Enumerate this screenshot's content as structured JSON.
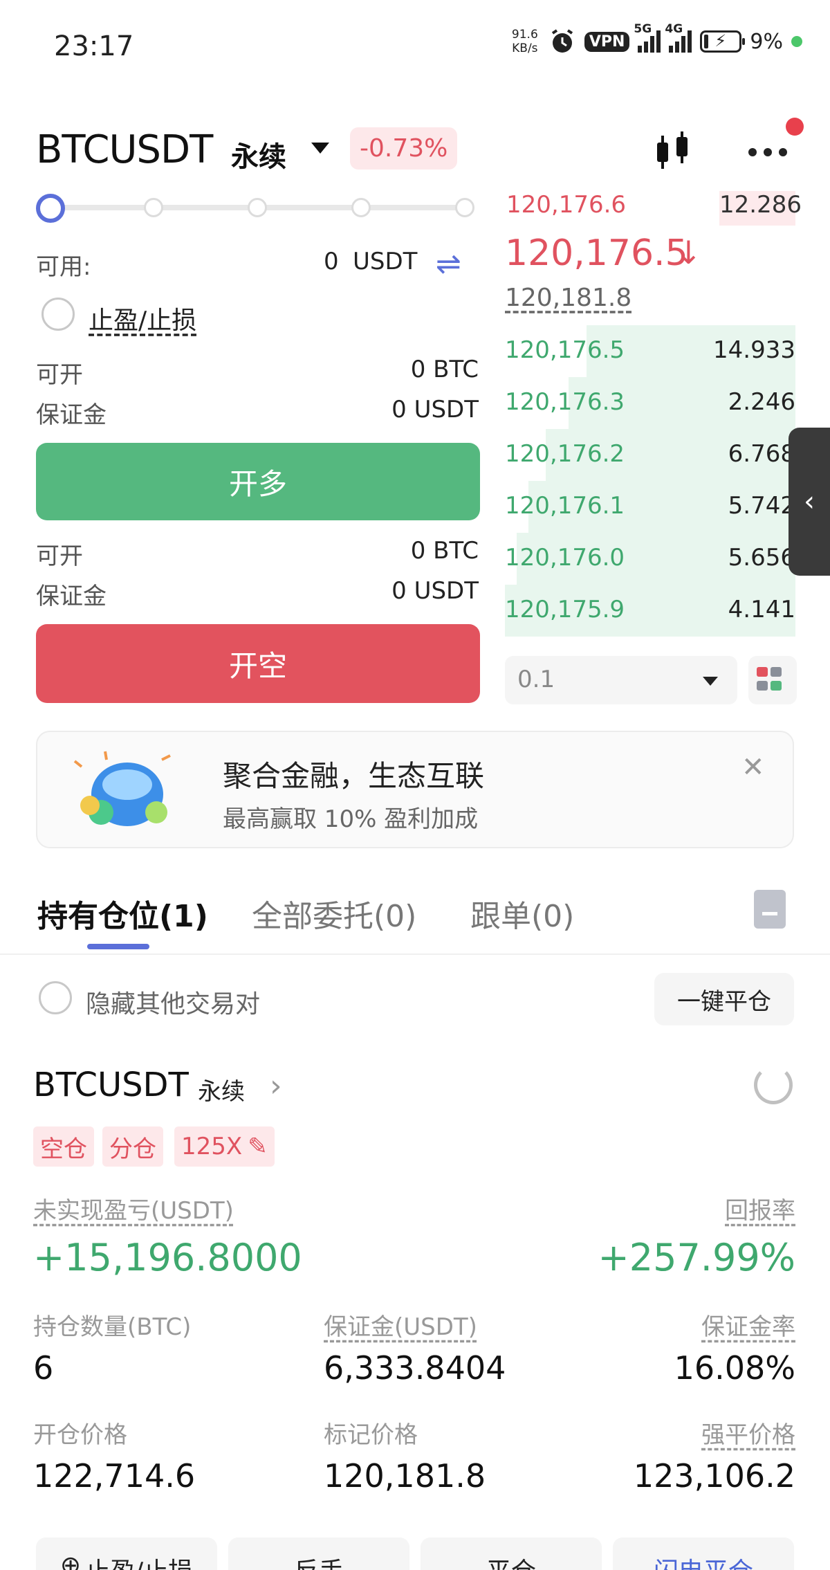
{
  "status_bar": {
    "time": "23:17",
    "net_speed_value": "91.6",
    "net_speed_unit": "KB/s",
    "vpn": "VPN",
    "sim1": "5G",
    "sim2": "4G",
    "battery": "9%",
    "icons": [
      "alarm-icon",
      "signal-icon",
      "battery-charging-icon"
    ]
  },
  "header": {
    "symbol": "BTCUSDT",
    "contract": "永续",
    "change": "-0.73%"
  },
  "order_form": {
    "available_label": "可用:",
    "available_value": "0",
    "available_unit": "USDT",
    "tp_sl_label": "止盈/止损",
    "long": {
      "open_label": "可开",
      "open_value": "0 BTC",
      "margin_label": "保证金",
      "margin_value": "0 USDT",
      "button": "开多"
    },
    "short": {
      "open_label": "可开",
      "open_value": "0 BTC",
      "margin_label": "保证金",
      "margin_value": "0 USDT",
      "button": "开空"
    }
  },
  "order_book": {
    "top_ask": {
      "price": "120,176.6",
      "qty": "12.286"
    },
    "last_price": "120,176.5",
    "mark_price": "120,181.8",
    "bids": [
      {
        "price": "120,176.5",
        "qty": "14.933",
        "depth": 0.72
      },
      {
        "price": "120,176.3",
        "qty": "2.246",
        "depth": 0.78
      },
      {
        "price": "120,176.2",
        "qty": "6.768",
        "depth": 0.86
      },
      {
        "price": "120,176.1",
        "qty": "5.742",
        "depth": 0.92
      },
      {
        "price": "120,176.0",
        "qty": "5.656",
        "depth": 0.96
      },
      {
        "price": "120,175.9",
        "qty": "4.141",
        "depth": 1.0
      }
    ],
    "depth_precision": "0.1"
  },
  "banner": {
    "title": "聚合金融，生态互联",
    "subtitle": "最高赢取 10% 盈利加成"
  },
  "tabs": [
    {
      "label": "持有仓位(1)",
      "active": true
    },
    {
      "label": "全部委托(0)",
      "active": false
    },
    {
      "label": "跟单(0)",
      "active": false
    }
  ],
  "filter": {
    "hide_other_label": "隐藏其他交易对",
    "close_all": "一键平仓"
  },
  "position": {
    "symbol": "BTCUSDT",
    "contract": "永续",
    "tags": [
      "空仓",
      "分仓",
      "125X"
    ],
    "pnl_label": "未实现盈亏(USDT)",
    "pnl_value": "+15,196.8000",
    "roi_label": "回报率",
    "roi_value": "+257.99%",
    "qty_label": "持仓数量(BTC)",
    "qty_value": "6",
    "margin_label": "保证金(USDT)",
    "margin_value": "6,333.8404",
    "margin_rate_label": "保证金率",
    "margin_rate_value": "16.08%",
    "entry_label": "开仓价格",
    "entry_value": "122,714.6",
    "mark_label": "标记价格",
    "mark_value": "120,181.8",
    "liq_label": "强平价格",
    "liq_value": "123,106.2"
  },
  "actions": [
    "止盈/止损",
    "反手",
    "平仓",
    "闪电平仓"
  ],
  "colors": {
    "accent": "#5b6fd9",
    "long": "#55b87f",
    "short": "#e2535e",
    "profit": "#3fa86e"
  }
}
